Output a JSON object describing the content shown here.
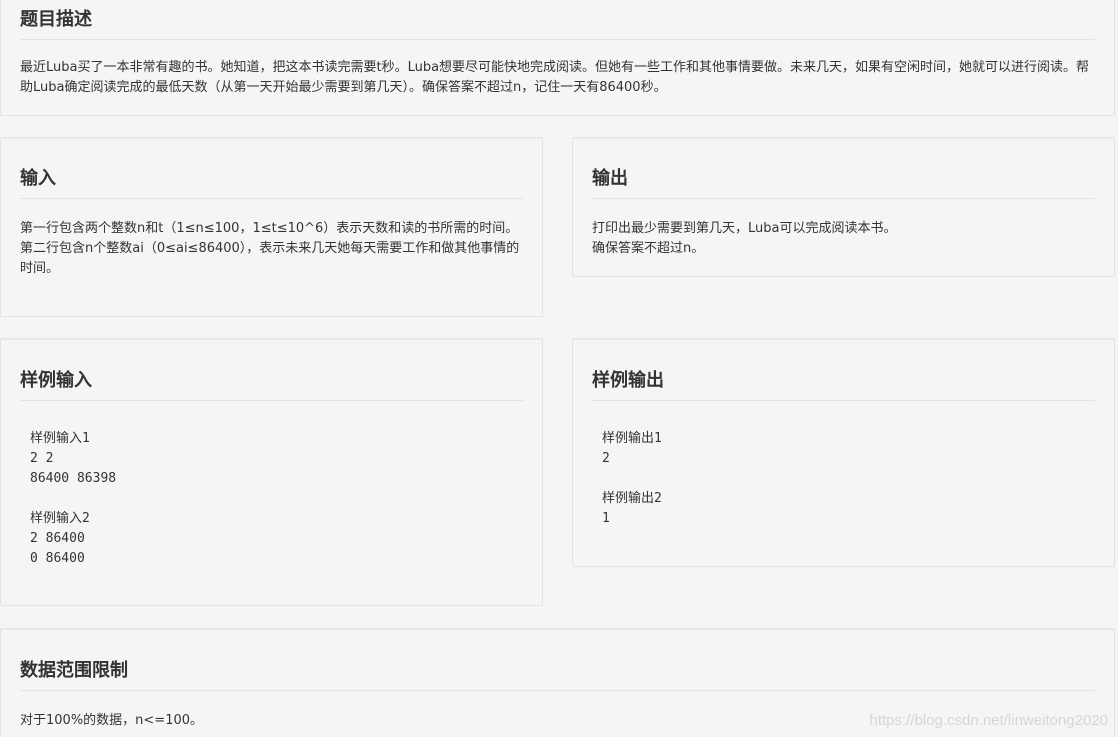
{
  "description": {
    "title": "题目描述",
    "text": "最近Luba买了一本非常有趣的书。她知道，把这本书读完需要t秒。Luba想要尽可能快地完成阅读。但她有一些工作和其他事情要做。未来几天，如果有空闲时间，她就可以进行阅读。帮助Luba确定阅读完成的最低天数（从第一天开始最少需要到第几天）。确保答案不超过n，记住一天有86400秒。"
  },
  "input": {
    "title": "输入",
    "text": "第一行包含两个整数n和t（1≤n≤100，1≤t≤10^6）表示天数和读的书所需的时间。\n第二行包含n个整数ai（0≤ai≤86400），表示未来几天她每天需要工作和做其他事情的时间。"
  },
  "output": {
    "title": "输出",
    "text": "打印出最少需要到第几天，Luba可以完成阅读本书。\n确保答案不超过n。"
  },
  "sample_input": {
    "title": "样例输入",
    "text": "样例输入1\n2 2\n86400 86398\n\n样例输入2\n2 86400\n0 86400"
  },
  "sample_output": {
    "title": "样例输出",
    "text": "样例输出1\n2\n\n样例输出2\n1"
  },
  "constraints": {
    "title": "数据范围限制",
    "text": "对于100%的数据，n<=100。"
  },
  "watermark": "https://blog.csdn.net/linweitong2020"
}
